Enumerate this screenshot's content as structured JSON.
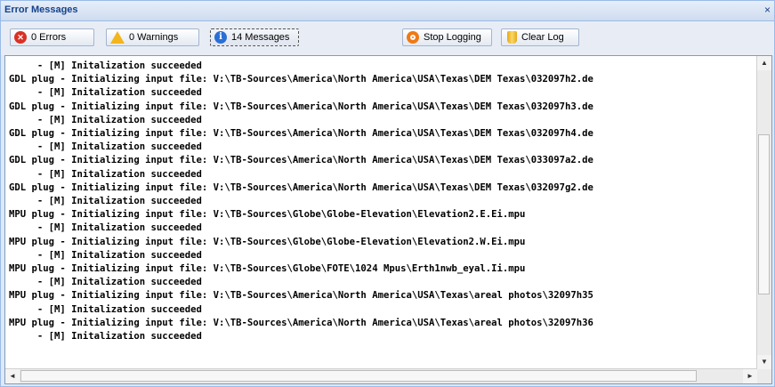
{
  "panel": {
    "title": "Error Messages",
    "close_label": "×"
  },
  "toolbar": {
    "errors_label": "0 Errors",
    "warnings_label": "0 Warnings",
    "messages_label": "14 Messages",
    "stop_logging_label": "Stop Logging",
    "clear_log_label": "Clear Log"
  },
  "log": {
    "lines": [
      "     - [M] Initalization succeeded",
      "GDL plug - Initializing input file: V:\\TB-Sources\\America\\North America\\USA\\Texas\\DEM Texas\\032097h2.de",
      "     - [M] Initalization succeeded",
      "GDL plug - Initializing input file: V:\\TB-Sources\\America\\North America\\USA\\Texas\\DEM Texas\\032097h3.de",
      "     - [M] Initalization succeeded",
      "GDL plug - Initializing input file: V:\\TB-Sources\\America\\North America\\USA\\Texas\\DEM Texas\\032097h4.de",
      "     - [M] Initalization succeeded",
      "GDL plug - Initializing input file: V:\\TB-Sources\\America\\North America\\USA\\Texas\\DEM Texas\\033097a2.de",
      "     - [M] Initalization succeeded",
      "GDL plug - Initializing input file: V:\\TB-Sources\\America\\North America\\USA\\Texas\\DEM Texas\\032097g2.de",
      "     - [M] Initalization succeeded",
      "MPU plug - Initializing input file: V:\\TB-Sources\\Globe\\Globe-Elevation\\Elevation2.E.Ei.mpu",
      "     - [M] Initalization succeeded",
      "MPU plug - Initializing input file: V:\\TB-Sources\\Globe\\Globe-Elevation\\Elevation2.W.Ei.mpu",
      "     - [M] Initalization succeeded",
      "MPU plug - Initializing input file: V:\\TB-Sources\\Globe\\FOTE\\1024 Mpus\\Erth1nwb_eyal.Ii.mpu",
      "     - [M] Initalization succeeded",
      "MPU plug - Initializing input file: V:\\TB-Sources\\America\\North America\\USA\\Texas\\areal photos\\32097h35",
      "     - [M] Initalization succeeded",
      "MPU plug - Initializing input file: V:\\TB-Sources\\America\\North America\\USA\\Texas\\areal photos\\32097h36",
      "     - [M] Initalization succeeded"
    ]
  },
  "scrollbars": {
    "up_arrow": "▲",
    "down_arrow": "▼",
    "left_arrow": "◄",
    "right_arrow": "►"
  }
}
